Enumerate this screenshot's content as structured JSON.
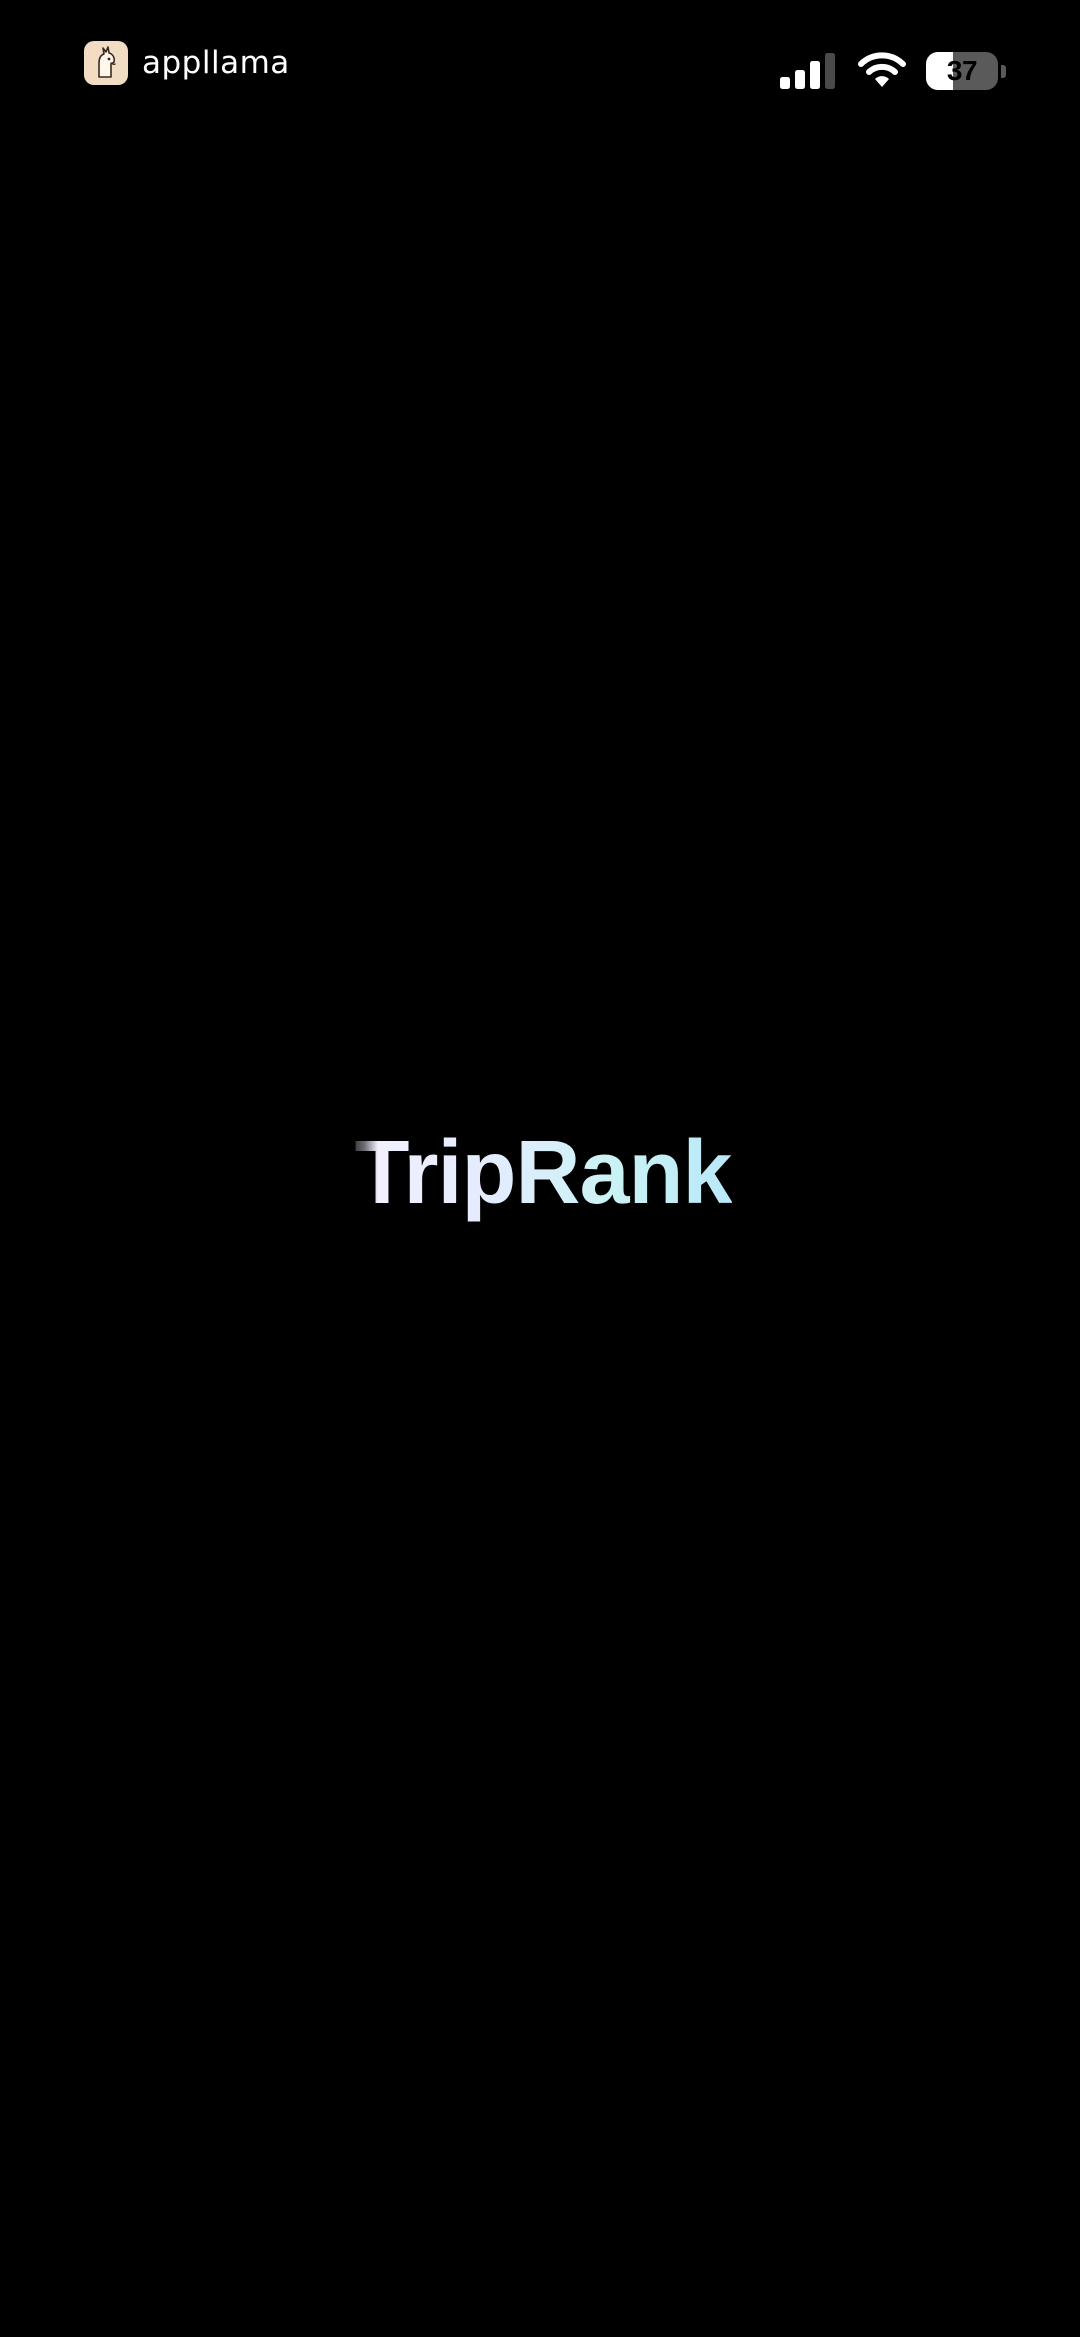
{
  "status_bar": {
    "brand_name": "appllama",
    "brand_icon": "llama-icon",
    "signal_icon": "cellular-signal-icon",
    "signal_bars_active": 3,
    "signal_bars_total": 4,
    "wifi_icon": "wifi-icon",
    "battery_icon": "battery-icon",
    "battery_level": "37",
    "battery_fraction": 0.37
  },
  "splash": {
    "app_name": "TripRank"
  },
  "colors": {
    "background": "#000000",
    "status_foreground": "#ffffff",
    "logo_gradient_start": "#f4f1ff",
    "logo_gradient_end": "#b9e8fa",
    "brand_icon_background": "#f3dcc4"
  }
}
